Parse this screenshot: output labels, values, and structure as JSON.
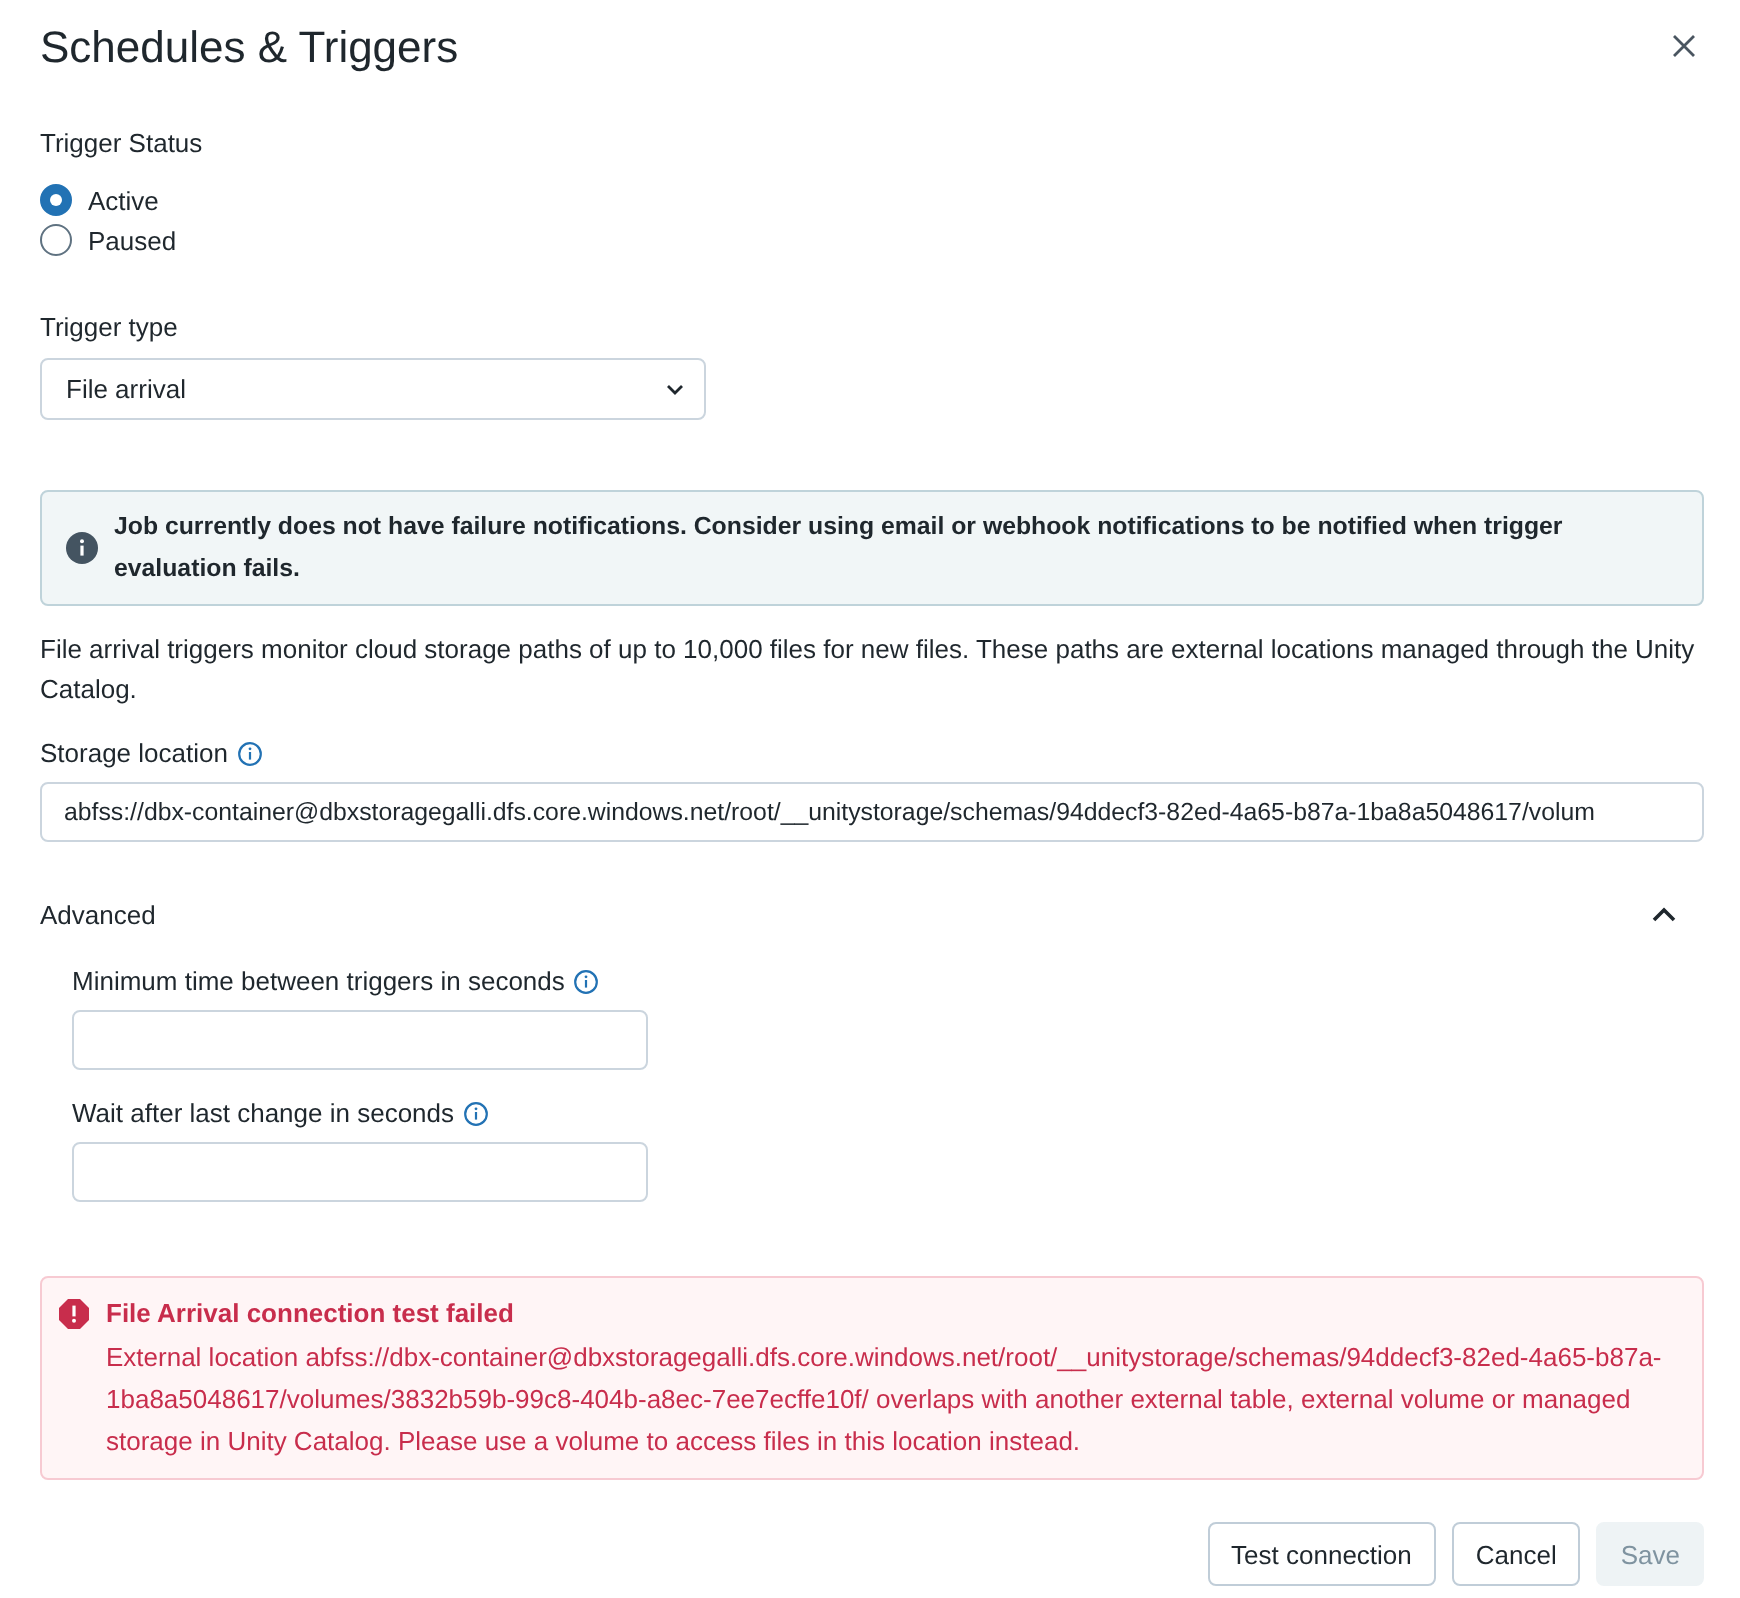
{
  "dialog": {
    "title": "Schedules & Triggers"
  },
  "trigger_status": {
    "label": "Trigger Status",
    "options": [
      {
        "label": "Active",
        "selected": true
      },
      {
        "label": "Paused",
        "selected": false
      }
    ]
  },
  "trigger_type": {
    "label": "Trigger type",
    "value": "File arrival"
  },
  "notice": {
    "text": "Job currently does not have failure notifications. Consider using email or webhook notifications to be notified when trigger evaluation fails."
  },
  "description": "File arrival triggers monitor cloud storage paths of up to 10,000 files for new files. These paths are external locations managed through the Unity Catalog.",
  "storage_location": {
    "label": "Storage location",
    "value": "abfss://dbx-container@dbxstoragegalli.dfs.core.windows.net/root/__unitystorage/schemas/94ddecf3-82ed-4a65-b87a-1ba8a5048617/volum"
  },
  "advanced": {
    "label": "Advanced",
    "expanded": true,
    "fields": [
      {
        "label": "Minimum time between triggers in seconds"
      },
      {
        "label": "Wait after last change in seconds"
      }
    ]
  },
  "error": {
    "title": "File Arrival connection test failed",
    "message": "External location abfss://dbx-container@dbxstoragegalli.dfs.core.windows.net/root/__unitystorage/schemas/94ddecf3-82ed-4a65-b87a-1ba8a5048617/volumes/3832b59b-99c8-404b-a8ec-7ee7ecffe10f/ overlaps with another external table, external volume or managed storage in Unity Catalog. Please use a volume to access files in this location instead."
  },
  "buttons": [
    {
      "label": "Test connection",
      "disabled": false
    },
    {
      "label": "Cancel",
      "disabled": false
    },
    {
      "label": "Save",
      "disabled": true
    }
  ]
}
